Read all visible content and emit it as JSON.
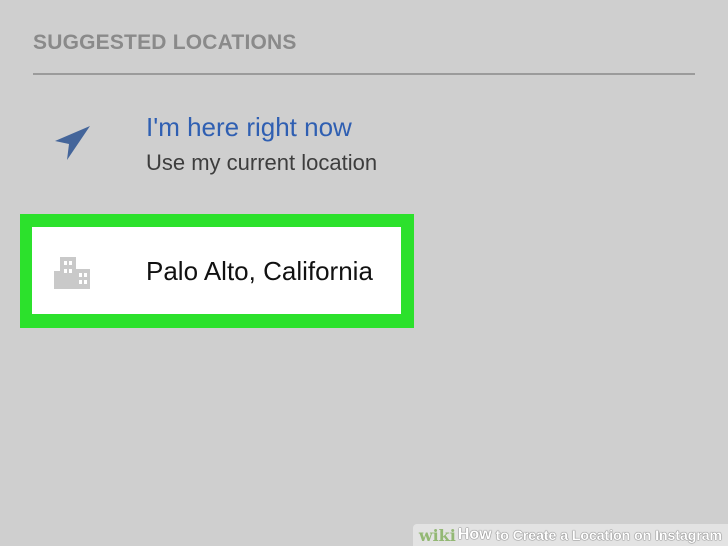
{
  "section": {
    "header": "SUGGESTED LOCATIONS"
  },
  "current_location": {
    "icon": "location-arrow-icon",
    "title": "I'm here right now",
    "subtitle": "Use my current location"
  },
  "suggested_items": [
    {
      "icon": "building-icon",
      "label": "Palo Alto, California"
    }
  ],
  "watermark": {
    "wiki": "wiki",
    "how": "How",
    "rest": "to Create a Location on Instagram"
  },
  "colors": {
    "background": "#cfcfcf",
    "title_blue": "#2f5fb2",
    "highlight_green": "#2ce12c",
    "icon_gray": "#c9c9c9"
  }
}
